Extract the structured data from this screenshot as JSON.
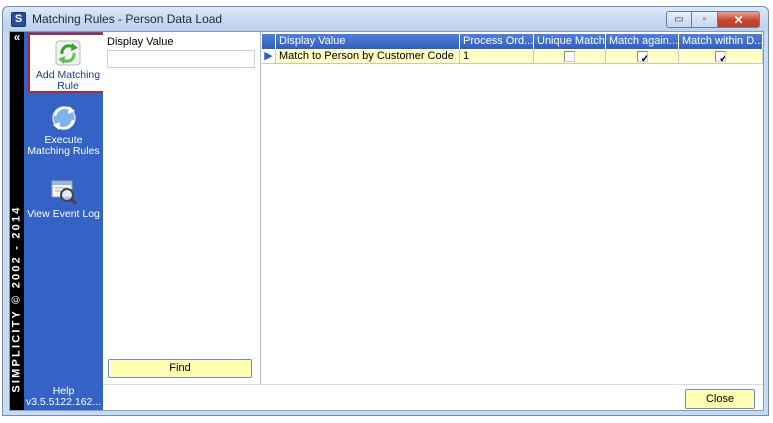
{
  "window": {
    "app_icon_letter": "S",
    "title": "Matching Rules - Person Data Load",
    "controls": {
      "minimize": "▭",
      "maximize": "▫",
      "close": "✕"
    }
  },
  "brand": {
    "collapse_glyph": "«",
    "vertical_text": "SIMPLICITY © 2002 - 2014"
  },
  "sidebar": {
    "items": [
      {
        "label": "Add Matching Rule",
        "icon": "add-refresh-icon",
        "selected": true
      },
      {
        "label": "Execute Matching Rules",
        "icon": "execute-globe-icon",
        "selected": false
      },
      {
        "label": "View Event Log",
        "icon": "magnifier-log-icon",
        "selected": false
      }
    ],
    "help_label": "Help",
    "version": "v3.5.5122.162..."
  },
  "filter": {
    "label": "Display Value",
    "value": "",
    "find_label": "Find"
  },
  "grid": {
    "columns": [
      "Display Value",
      "Process Ord...",
      "Unique Match",
      "Match  again...",
      "Match within D..."
    ],
    "rows": [
      {
        "display_value": "Match to Person by Customer Code",
        "process_order": "1",
        "unique_match": false,
        "match_against": true,
        "match_within": true
      }
    ],
    "row_indicator": "▶"
  },
  "footer": {
    "close_label": "Close"
  },
  "colors": {
    "sidebar_blue": "#3462c5",
    "header_blue": "#315fbd",
    "row_highlight": "#ffffc6",
    "button_yellow": "#ffffb3",
    "selected_border": "#b0292b"
  }
}
